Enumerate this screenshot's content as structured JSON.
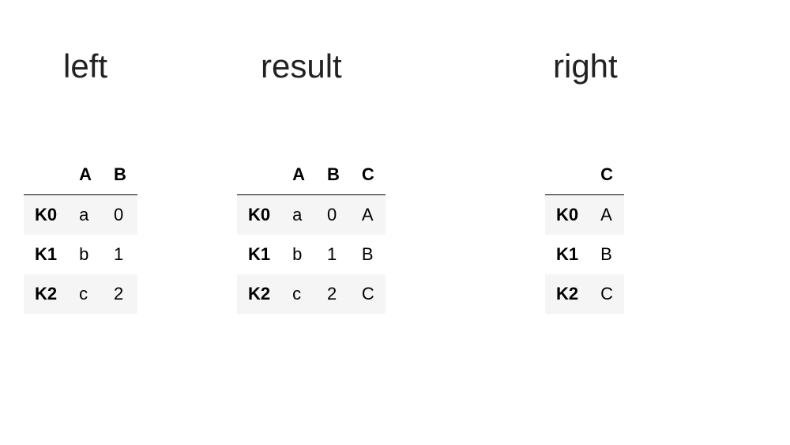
{
  "titles": {
    "left": "left",
    "result": "result",
    "right": "right"
  },
  "tables": {
    "left": {
      "columns": [
        "A",
        "B"
      ],
      "index": [
        "K0",
        "K1",
        "K2"
      ],
      "rows": [
        [
          "a",
          "0"
        ],
        [
          "b",
          "1"
        ],
        [
          "c",
          "2"
        ]
      ]
    },
    "result": {
      "columns": [
        "A",
        "B",
        "C"
      ],
      "index": [
        "K0",
        "K1",
        "K2"
      ],
      "rows": [
        [
          "a",
          "0",
          "A"
        ],
        [
          "b",
          "1",
          "B"
        ],
        [
          "c",
          "2",
          "C"
        ]
      ]
    },
    "right": {
      "columns": [
        "C"
      ],
      "index": [
        "K0",
        "K1",
        "K2"
      ],
      "rows": [
        [
          "A"
        ],
        [
          "B"
        ],
        [
          "C"
        ]
      ]
    }
  }
}
